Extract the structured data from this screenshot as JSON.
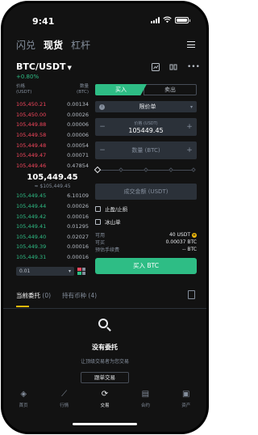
{
  "status": {
    "time": "9:41"
  },
  "top_tabs": [
    "闪兑",
    "现货",
    "杠杆"
  ],
  "active_top_tab": 1,
  "pair": {
    "symbol": "BTC/USDT",
    "change": "+0.80%"
  },
  "book": {
    "price_header": "价格\n(USDT)",
    "qty_header": "数量\n(BTC)",
    "asks": [
      {
        "price": "105,450.21",
        "qty": "0.00134"
      },
      {
        "price": "105,450.00",
        "qty": "0.00026"
      },
      {
        "price": "105,449.88",
        "qty": "0.00006"
      },
      {
        "price": "105,449.58",
        "qty": "0.00006"
      },
      {
        "price": "105,449.48",
        "qty": "0.00054"
      },
      {
        "price": "105,449.47",
        "qty": "0.00071"
      },
      {
        "price": "105,449.46",
        "qty": "0.47854"
      }
    ],
    "mid_price": "105,449.45",
    "mid_usd": "≈ $105,449.45",
    "bids": [
      {
        "price": "105,449.45",
        "qty": "6.10109"
      },
      {
        "price": "105,449.44",
        "qty": "0.00026"
      },
      {
        "price": "105,449.42",
        "qty": "0.00016"
      },
      {
        "price": "105,449.41",
        "qty": "0.01295"
      },
      {
        "price": "105,449.40",
        "qty": "0.02027"
      },
      {
        "price": "105,449.39",
        "qty": "0.00016"
      },
      {
        "price": "105,449.31",
        "qty": "0.00016"
      }
    ],
    "depth": "0.01"
  },
  "form": {
    "buy_label": "买入",
    "sell_label": "卖出",
    "order_type": "限价单",
    "price_caption": "价格 (USDT)",
    "price_value": "105449.45",
    "qty_placeholder": "数量 (BTC)",
    "total_placeholder": "成交金额 (USDT)",
    "tp_sl_label": "止盈/止损",
    "iceberg_label": "冰山单",
    "available_label": "可用",
    "available_value": "40 USDT",
    "buyable_label": "可买",
    "buyable_value": "0.00037 BTC",
    "fee_label": "预估手续费",
    "fee_value": "-- BTC",
    "submit_label": "买入 BTC"
  },
  "orders": {
    "tab_open": "当前委托",
    "tab_open_count": "(0)",
    "tab_holdings": "持有币种",
    "tab_holdings_count": "(4)",
    "empty_title": "没有委托",
    "empty_sub": "让顶级交易者为您交易",
    "follow_label": "跟单交易"
  },
  "nav": [
    {
      "label": "首页",
      "icon": "home-icon"
    },
    {
      "label": "行情",
      "icon": "markets-icon"
    },
    {
      "label": "交易",
      "icon": "trade-icon"
    },
    {
      "label": "合约",
      "icon": "futures-icon"
    },
    {
      "label": "资产",
      "icon": "wallet-icon"
    }
  ],
  "active_nav": 2,
  "colors": {
    "buy": "#2ebd85",
    "sell": "#f6465d",
    "accent": "#f0b90b",
    "bg": "#121212"
  }
}
